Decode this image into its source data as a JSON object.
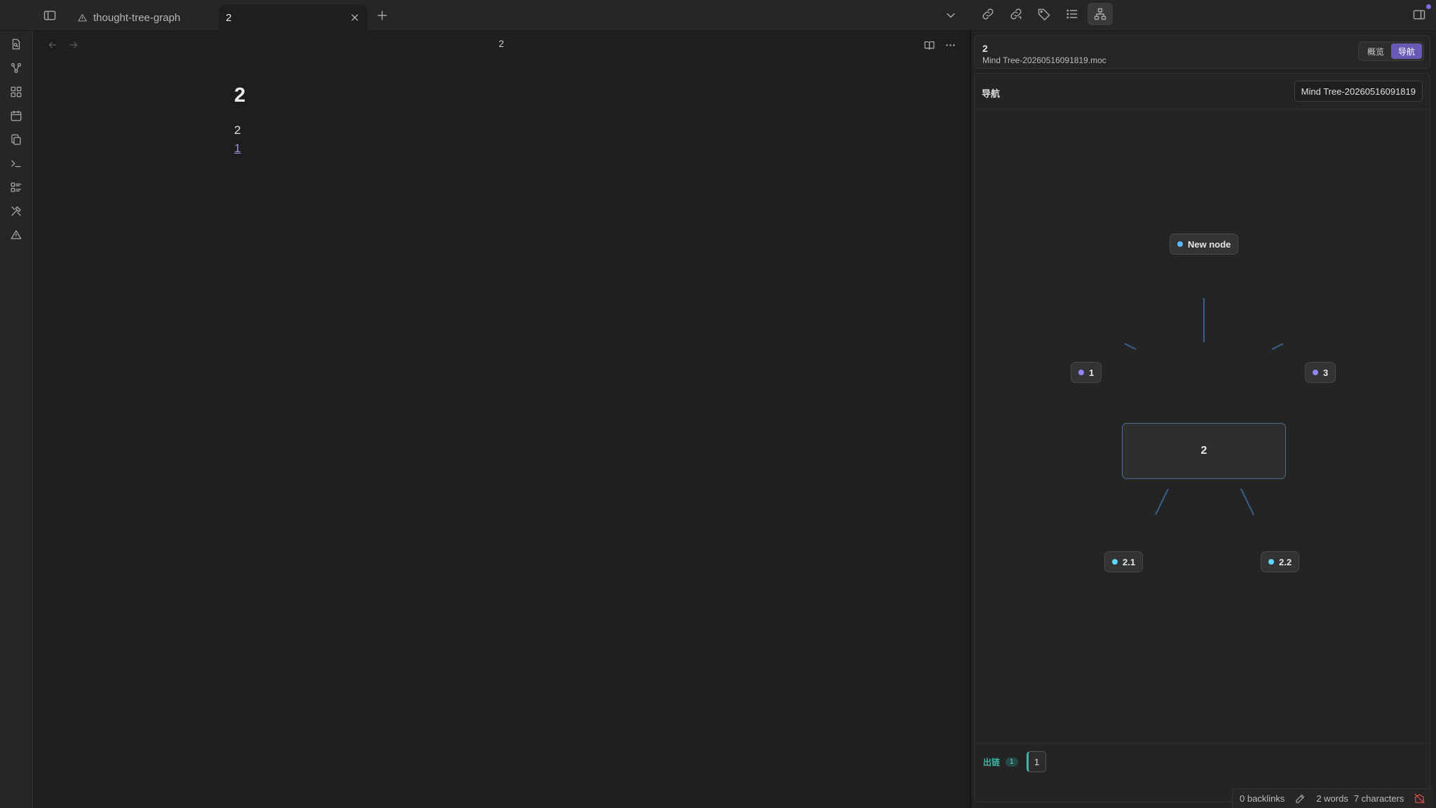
{
  "titlebar": {
    "tabs": [
      {
        "label": "thought-tree-graph",
        "icon": "triangle-alert-icon"
      },
      {
        "label": "2",
        "icon": "close-icon"
      }
    ]
  },
  "editor": {
    "view_title": "2",
    "doc": {
      "heading": "2",
      "paragraph": "2",
      "link": "1"
    }
  },
  "panel": {
    "title": "2",
    "subtitle": "Mind Tree-20260516091819.moc",
    "segments": [
      {
        "label": "概览",
        "active": false
      },
      {
        "label": "导航",
        "active": true
      }
    ],
    "nav_label": "导航",
    "moc_select": "Mind Tree-20260516091819",
    "graph": {
      "center": "2",
      "parent": {
        "label": "New node",
        "dot": "#5fb7ff"
      },
      "siblings": [
        {
          "label": "1",
          "dot": "#8f86ff"
        },
        {
          "label": "3",
          "dot": "#8f86ff"
        }
      ],
      "children": [
        {
          "label": "2.1",
          "dot": "#5fd7ff"
        },
        {
          "label": "2.2",
          "dot": "#5fd7ff"
        }
      ]
    },
    "outlinks": {
      "label": "出链",
      "count": "1",
      "items": [
        "1"
      ]
    }
  },
  "statusbar": {
    "backlinks": "0 backlinks",
    "words": "2 words",
    "characters": "7 characters"
  },
  "colors": {
    "accent": "#6a58b6",
    "edge": "#3b5f8e",
    "teal": "#3fb6a8",
    "link": "#a08ed6"
  }
}
